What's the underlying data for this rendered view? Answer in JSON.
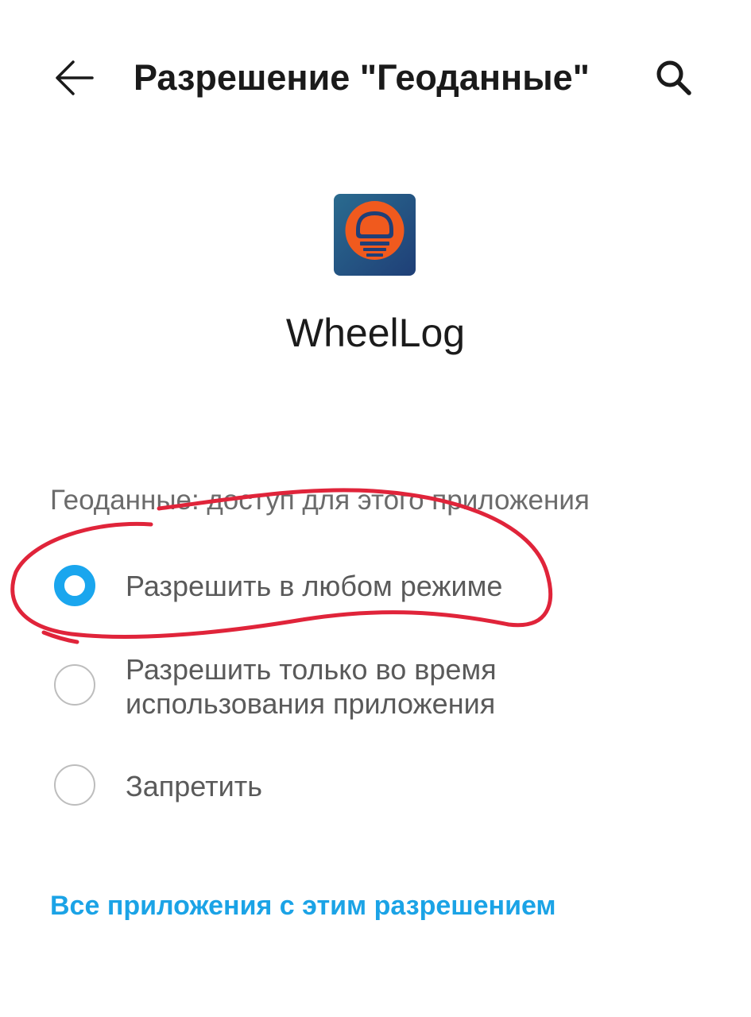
{
  "header": {
    "title": "Разрешение \"Геоданные\"",
    "back_icon": "arrow-left-icon",
    "search_icon": "search-icon"
  },
  "app": {
    "name": "WheelLog",
    "icon": "wheellog-app-icon",
    "icon_colors": {
      "background": "#2c5f8e",
      "accent": "#f05a1e"
    }
  },
  "permission": {
    "section_label": "Геоданные: доступ для этого приложения",
    "selected_index": 0,
    "options": [
      {
        "label": "Разрешить в любом режиме",
        "selected": true
      },
      {
        "label": "Разрешить только во время использования приложения",
        "selected": false
      },
      {
        "label": "Запретить",
        "selected": false
      }
    ]
  },
  "footer_link": "Все приложения с этим разрешением",
  "colors": {
    "accent": "#1aa6ee",
    "link": "#1ba3e6",
    "annotation": "#e0243a"
  }
}
